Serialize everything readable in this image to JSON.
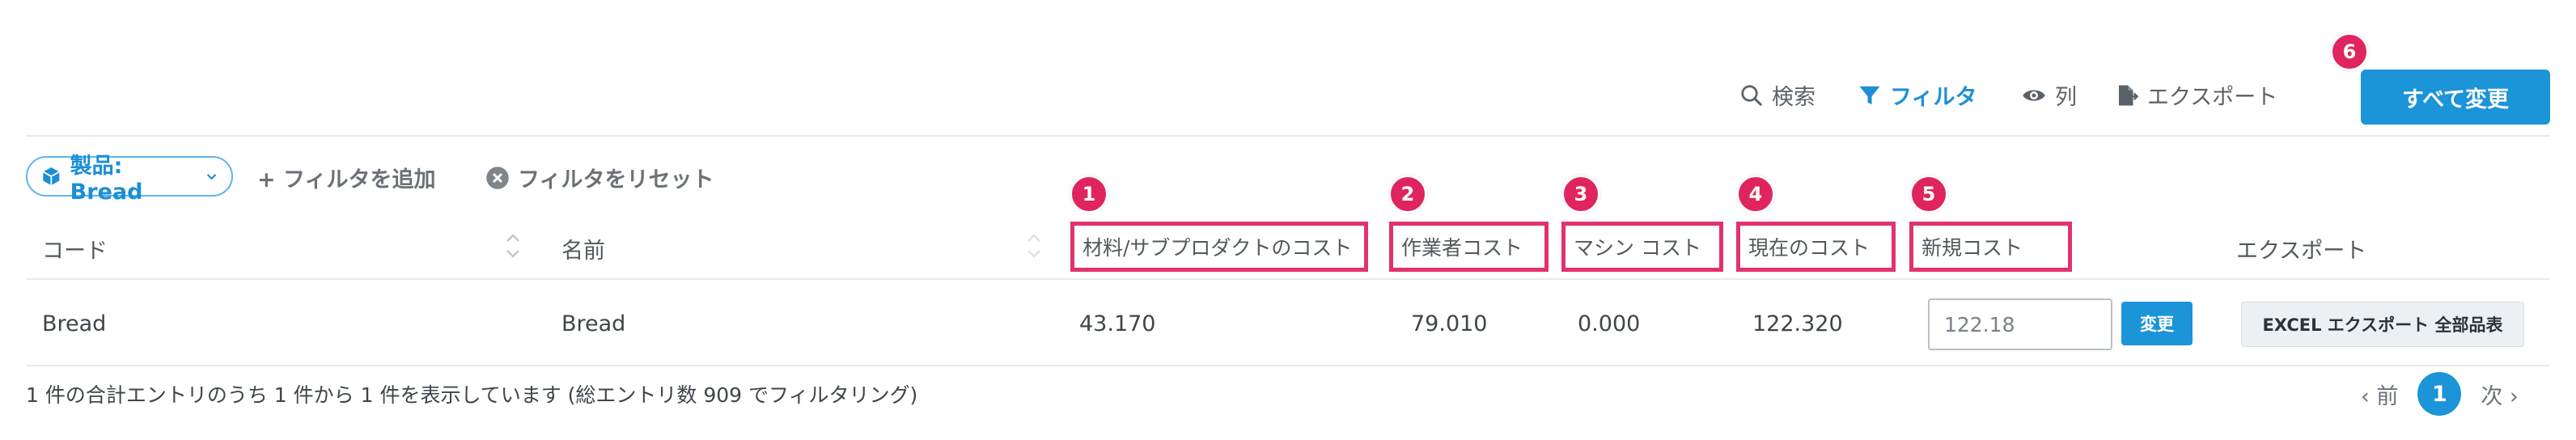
{
  "toolbar": {
    "search_label": "検索",
    "filter_label": "フィルタ",
    "columns_label": "列",
    "export_label": "エクスポート",
    "change_all_label": "すべて変更"
  },
  "filters": {
    "active_filter": "製品: Bread",
    "add_filter": "+ フィルタを追加",
    "reset_filter": "フィルタをリセット"
  },
  "badges": [
    "1",
    "2",
    "3",
    "4",
    "5",
    "6"
  ],
  "table": {
    "columns": [
      "コード",
      "名前",
      "材料/サブプロダクトのコスト",
      "作業者コスト",
      "マシン コスト",
      "現在のコスト",
      "新規コスト",
      "エクスポート"
    ],
    "rows": [
      {
        "code": "Bread",
        "name": "Bread",
        "material_cost": "43.170",
        "worker_cost": "79.010",
        "machine_cost": "0.000",
        "current_cost": "122.320",
        "new_cost_value": "122.18",
        "change_label": "変更",
        "export_label": "EXCEL エクスポート 全部品表"
      }
    ]
  },
  "footer": {
    "summary": "1 件の合計エントリのうち 1 件から 1 件を表示しています (総エントリ数 909 でフィルタリング)",
    "prev_label": "‹ 前",
    "current_page": "1",
    "next_label": "次 ›"
  },
  "colors": {
    "accent": "#1b94d8",
    "highlight_border": "#e1336a",
    "badge": "#e0245e"
  }
}
